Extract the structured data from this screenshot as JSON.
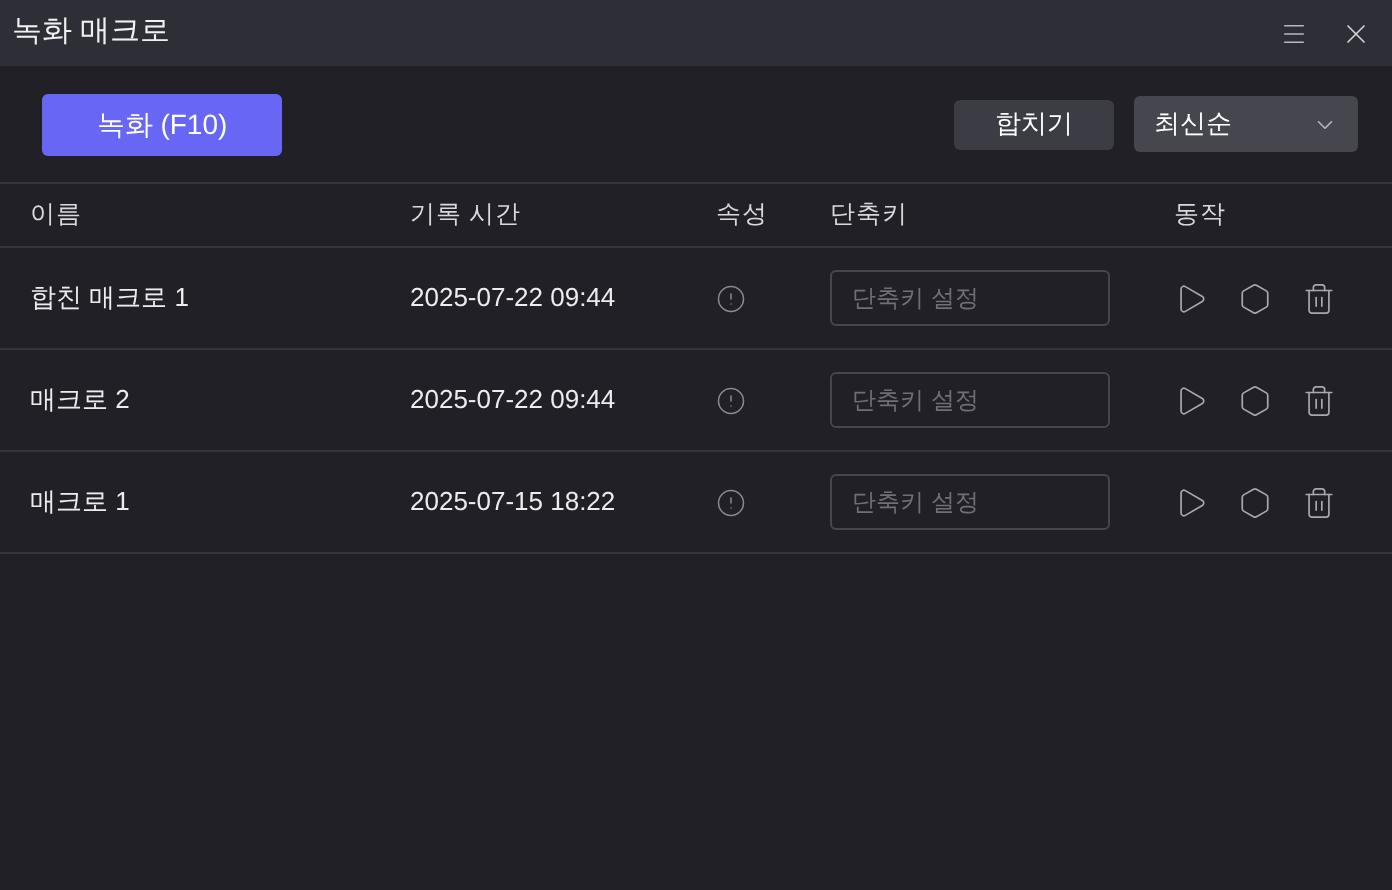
{
  "window": {
    "title": "녹화 매크로"
  },
  "toolbar": {
    "record_button": "녹화 (F10)",
    "merge_button": "합치기",
    "sort": {
      "value": "최신순"
    }
  },
  "table": {
    "columns": [
      "이름",
      "기록 시간",
      "속성",
      "단축키",
      "동작"
    ],
    "rows": [
      {
        "name": "합친 매크로 1",
        "time": "2025-07-22 09:44",
        "shortcut_placeholder": "단축키 설정"
      },
      {
        "name": "매크로 2",
        "time": "2025-07-22 09:44",
        "shortcut_placeholder": "단축키 설정"
      },
      {
        "name": "매크로 1",
        "time": "2025-07-15 18:22",
        "shortcut_placeholder": "단축키 설정"
      }
    ]
  }
}
